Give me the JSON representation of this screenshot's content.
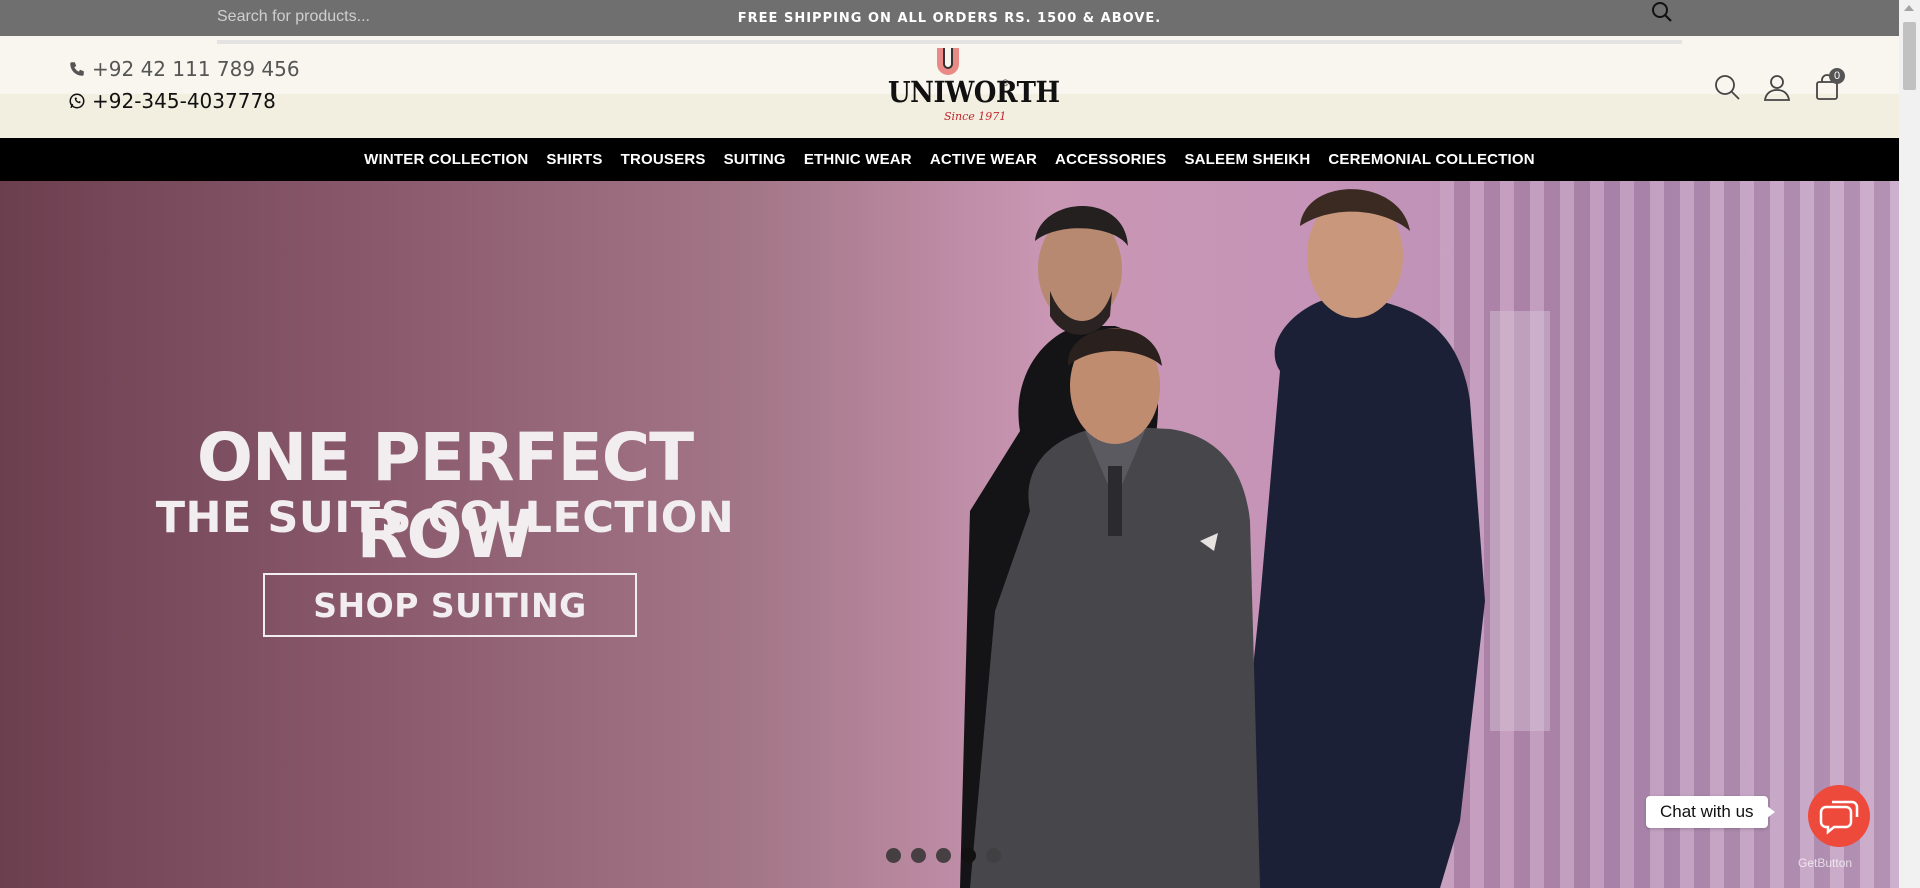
{
  "topbar": {
    "search_placeholder": "Search for products...",
    "shipping_text": "FREE SHIPPING ON ALL ORDERS RS. 1500 & ABOVE."
  },
  "header": {
    "phone": "+92 42 111 789 456",
    "whatsapp": "+92-345-4037778",
    "logo": {
      "letter": "U",
      "word": "UNIWORTH",
      "registered": "®",
      "since": "Since 1971"
    },
    "cart_count": "0"
  },
  "nav": {
    "items": [
      "WINTER COLLECTION",
      "SHIRTS",
      "TROUSERS",
      "SUITING",
      "ETHNIC WEAR",
      "ACTIVE WEAR",
      "ACCESSORIES",
      "SALEEM SHEIKH",
      "CEREMONIAL COLLECTION"
    ]
  },
  "hero": {
    "title": "ONE PERFECT ROW",
    "subtitle": "THE SUITS COLLECTION",
    "cta": "SHOP SUITING",
    "slides": 5,
    "active_slide": 4
  },
  "chat": {
    "label": "Chat with us",
    "brand": "GetButton"
  },
  "colors": {
    "topbar": "#6f6f6f",
    "nav": "#000000",
    "chat": "#ee4a3c",
    "logo_accent": "#e98a86"
  }
}
